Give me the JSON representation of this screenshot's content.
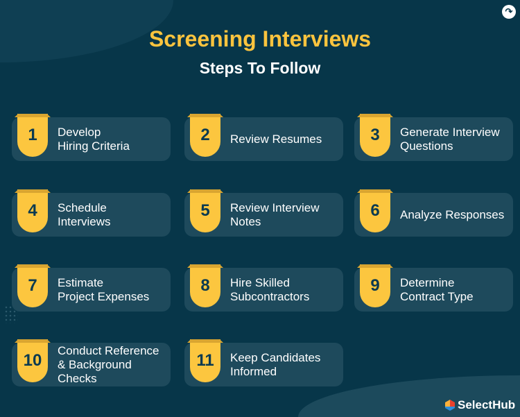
{
  "title": "Screening Interviews",
  "subtitle": "Steps To Follow",
  "colors": {
    "background": "#073649",
    "card": "#1e4a5c",
    "accent": "#fcc63f"
  },
  "share_icon": "share-arrow-icon",
  "steps": [
    {
      "num": "1",
      "label": "Develop\nHiring Criteria"
    },
    {
      "num": "2",
      "label": "Review Resumes"
    },
    {
      "num": "3",
      "label": "Generate Interview\nQuestions"
    },
    {
      "num": "4",
      "label": "Schedule\nInterviews"
    },
    {
      "num": "5",
      "label": "Review Interview\nNotes"
    },
    {
      "num": "6",
      "label": "Analyze Responses"
    },
    {
      "num": "7",
      "label": "Estimate\nProject Expenses"
    },
    {
      "num": "8",
      "label": "Hire Skilled\nSubcontractors"
    },
    {
      "num": "9",
      "label": "Determine\nContract Type"
    },
    {
      "num": "10",
      "label": "Conduct Reference\n& Background\nChecks"
    },
    {
      "num": "11",
      "label": "Keep Candidates\nInformed"
    }
  ],
  "logo": {
    "text": "SelectHub"
  }
}
